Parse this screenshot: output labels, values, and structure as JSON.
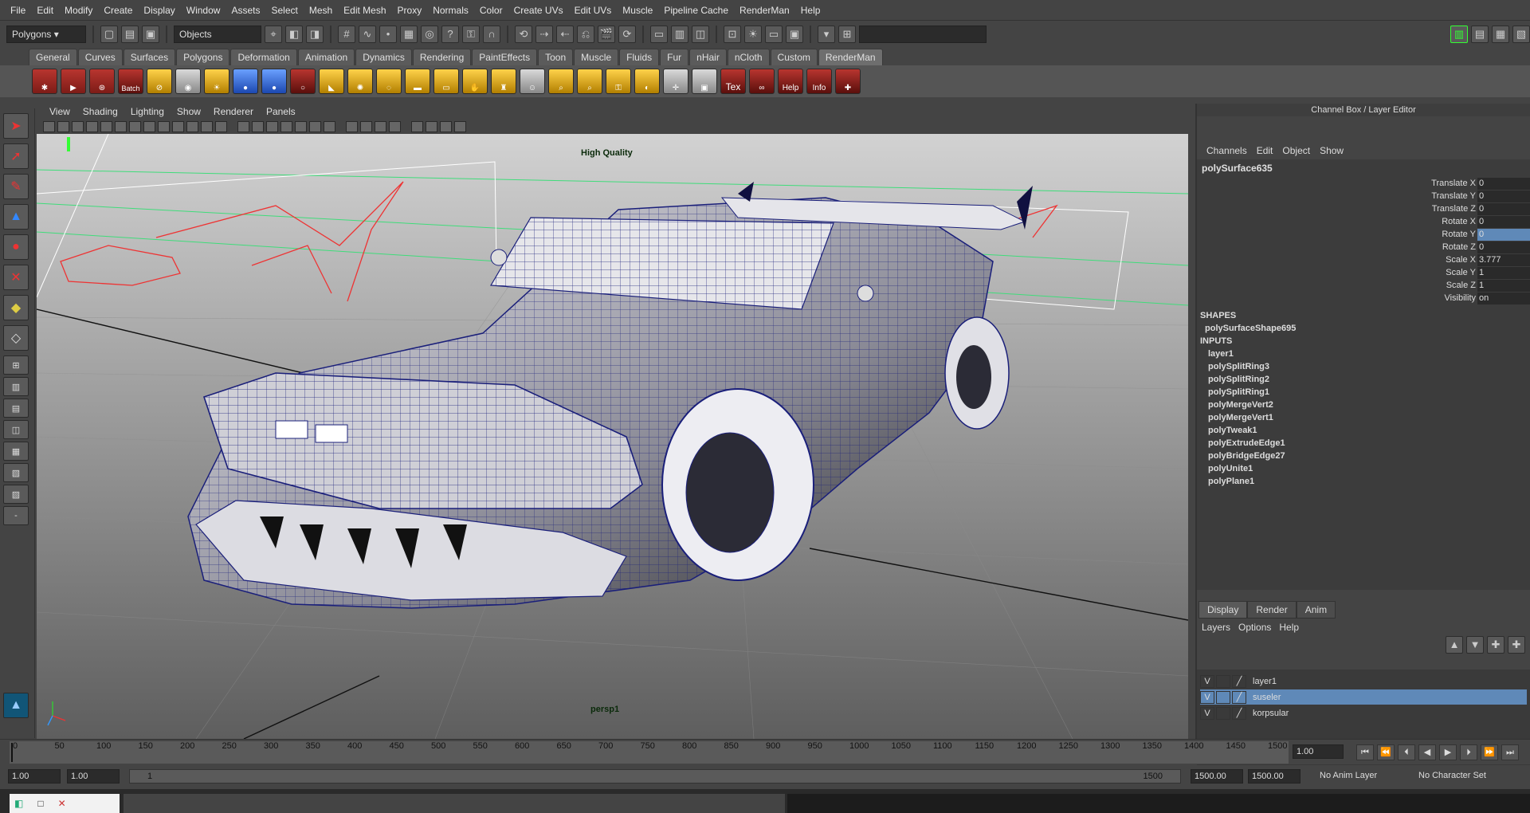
{
  "menubar": [
    "File",
    "Edit",
    "Modify",
    "Create",
    "Display",
    "Window",
    "Assets",
    "Select",
    "Mesh",
    "Edit Mesh",
    "Proxy",
    "Normals",
    "Color",
    "Create UVs",
    "Edit UVs",
    "Muscle",
    "Pipeline Cache",
    "RenderMan",
    "Help"
  ],
  "statusline": {
    "mode": "Polygons",
    "objects_label": "Objects"
  },
  "shelf_tabs": [
    "General",
    "Curves",
    "Surfaces",
    "Polygons",
    "Deformation",
    "Animation",
    "Dynamics",
    "Rendering",
    "PaintEffects",
    "Toon",
    "Muscle",
    "Fluids",
    "Fur",
    "nHair",
    "nCloth",
    "Custom",
    "RenderMan"
  ],
  "shelf_active": "RenderMan",
  "shelf_labels": {
    "batch": "Batch",
    "tex": "Tex",
    "help": "Help",
    "info": "Info"
  },
  "viewport": {
    "menu": [
      "View",
      "Shading",
      "Lighting",
      "Show",
      "Renderer",
      "Panels"
    ],
    "hud_top": "High Quality",
    "camera": "persp1"
  },
  "channel_box": {
    "title": "Channel Box / Layer Editor",
    "menu": [
      "Channels",
      "Edit",
      "Object",
      "Show"
    ],
    "object": "polySurface635",
    "channels": [
      {
        "name": "Translate X",
        "value": "0"
      },
      {
        "name": "Translate Y",
        "value": "0"
      },
      {
        "name": "Translate Z",
        "value": "0"
      },
      {
        "name": "Rotate X",
        "value": "0"
      },
      {
        "name": "Rotate Y",
        "value": "0"
      },
      {
        "name": "Rotate Z",
        "value": "0"
      },
      {
        "name": "Scale X",
        "value": "3.777"
      },
      {
        "name": "Scale Y",
        "value": "1"
      },
      {
        "name": "Scale Z",
        "value": "1"
      },
      {
        "name": "Visibility",
        "value": "on"
      }
    ],
    "shapes_label": "SHAPES",
    "shape": "polySurfaceShape695",
    "inputs_label": "INPUTS",
    "inputs": [
      "layer1",
      "polySplitRing3",
      "polySplitRing2",
      "polySplitRing1",
      "polyMergeVert2",
      "polyMergeVert1",
      "polyTweak1",
      "polyExtrudeEdge1",
      "polyBridgeEdge27",
      "polyUnite1",
      "polyPlane1"
    ]
  },
  "layer_editor": {
    "tabs": [
      "Display",
      "Render",
      "Anim"
    ],
    "menu": [
      "Layers",
      "Options",
      "Help"
    ],
    "layers": [
      {
        "v": "V",
        "name": "layer1",
        "selected": false
      },
      {
        "v": "V",
        "name": "suseler",
        "selected": true
      },
      {
        "v": "V",
        "name": "korpsular",
        "selected": false
      }
    ]
  },
  "timeline": {
    "ticks": [
      "0",
      "50",
      "100",
      "150",
      "200",
      "250",
      "300",
      "350",
      "400",
      "450",
      "500",
      "550",
      "600",
      "650",
      "700",
      "750",
      "800",
      "850",
      "900",
      "950",
      "1000",
      "1050",
      "1100",
      "1150",
      "1200",
      "1250",
      "1300",
      "1350",
      "1400",
      "1450",
      "1500"
    ],
    "current_frame": "1.00"
  },
  "range": {
    "start": "1.00",
    "start2": "1.00",
    "slider_start": "1",
    "slider_end": "1500",
    "end": "1500.00",
    "end2": "1500.00",
    "anim_layer": "No Anim Layer",
    "char_set": "No Character Set"
  }
}
